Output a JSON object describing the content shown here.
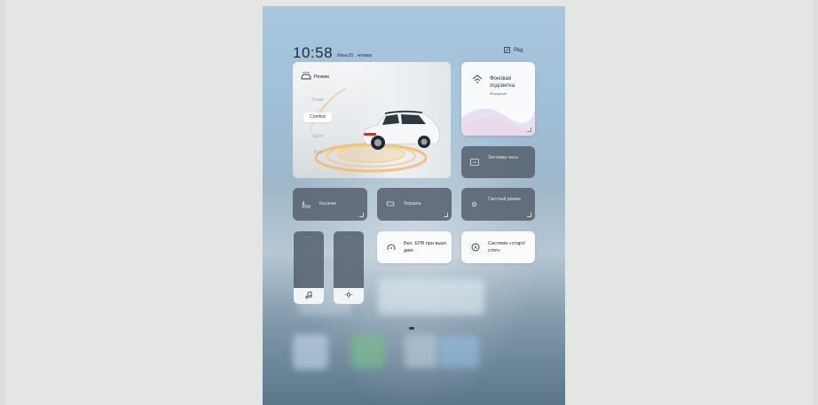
{
  "status": {
    "time": "10:58",
    "date": "Июнь25 , четверг",
    "edit_label": "Ред"
  },
  "mode_card": {
    "title": "Режим",
    "options": [
      "Smart",
      "Comfort",
      "Sport",
      "Eco"
    ],
    "selected": "Comfort"
  },
  "background_card": {
    "title": "Фоновая подсветка",
    "subtitle": "Мерцание"
  },
  "tiles": {
    "screensaver": "Заставка часы",
    "seats": "Касание",
    "mirrors": "Зеркала",
    "light_mode": "Светлый режим",
    "epb": "Вкл. EPB при выкл. двиг.",
    "start_stop": "Система «старт/стоп»"
  },
  "sliders": {
    "volume_icon": "music-note-icon",
    "brightness_icon": "sun-icon",
    "volume_level": 0.22,
    "brightness_level": 0.22
  },
  "colors": {
    "accent": "#f0a64a",
    "dark_tile": "#525c68"
  },
  "pager": {
    "pages": 2,
    "current": 1
  }
}
